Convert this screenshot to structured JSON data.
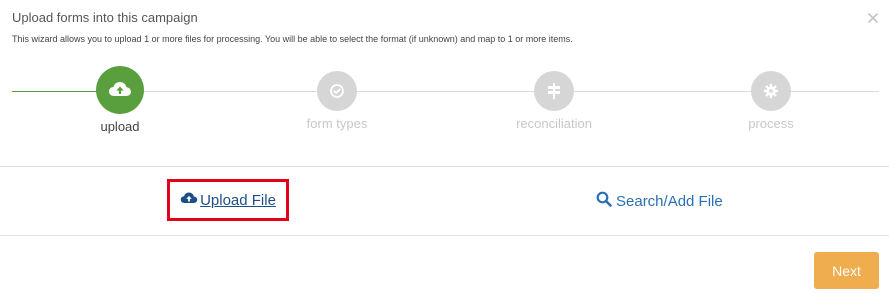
{
  "dialog": {
    "title": "Upload forms into this campaign",
    "subtitle": "This wizard allows you to upload 1 or more files for processing. You will be able to select the format (if unknown) and map to 1 or more items.",
    "close_icon": "close-icon"
  },
  "wizard": {
    "steps": [
      {
        "label": "upload",
        "icon": "cloud-upload-icon",
        "state": "active"
      },
      {
        "label": "form types",
        "icon": "check-circle-icon",
        "state": "inactive"
      },
      {
        "label": "reconciliation",
        "icon": "signpost-icon",
        "state": "inactive"
      },
      {
        "label": "process",
        "icon": "gear-icon",
        "state": "inactive"
      }
    ]
  },
  "actions": {
    "upload_file_label": "Upload File",
    "upload_icon": "cloud-upload-icon",
    "search_add_label": "Search/Add File",
    "search_icon": "search-icon"
  },
  "footer": {
    "next_label": "Next"
  },
  "colors": {
    "active_step": "#5a9f3e",
    "inactive_step": "#d6d6d6",
    "link": "#1d4f86",
    "highlight_box": "#e3001b",
    "next_button": "#f0ad4e"
  }
}
